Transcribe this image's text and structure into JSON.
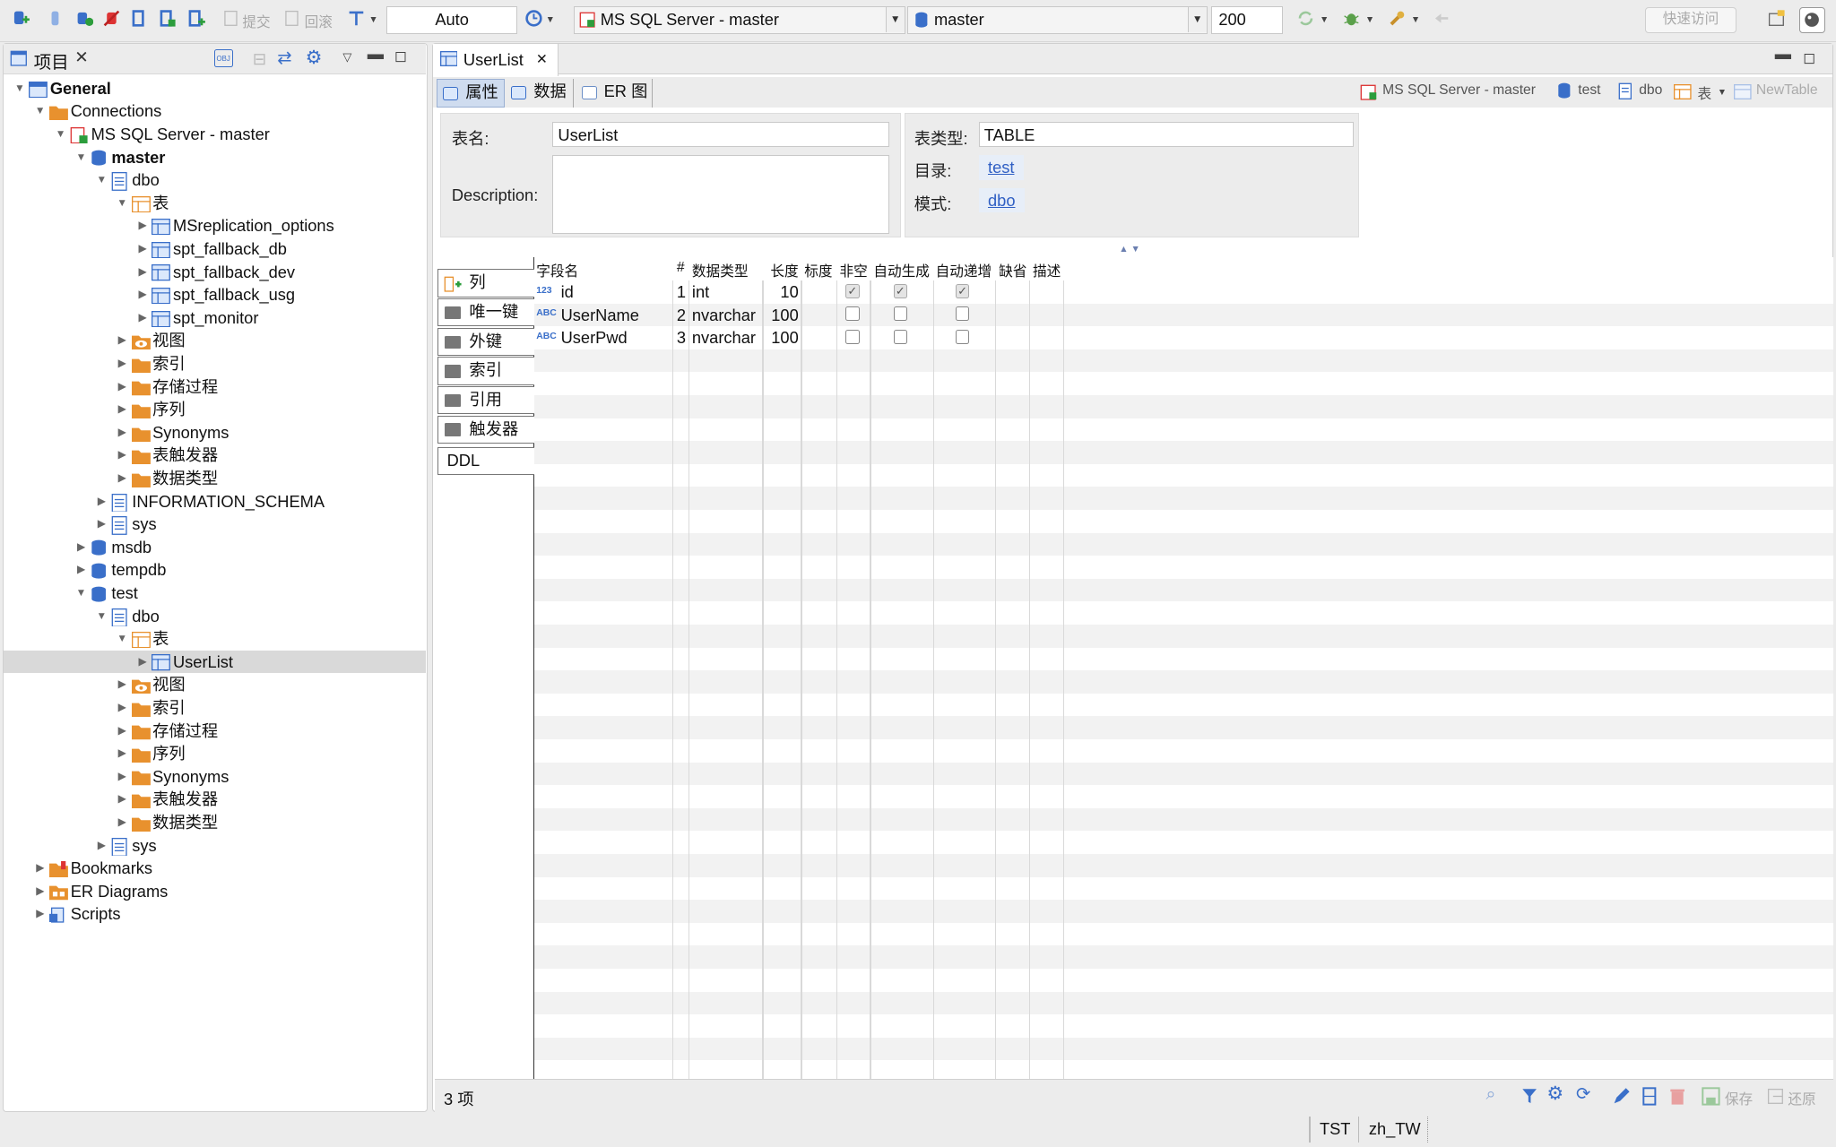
{
  "toolbar": {
    "commit_label": "提交",
    "rollback_label": "回滚",
    "mode_value": "Auto",
    "connection_value": "MS SQL Server - master",
    "database_value": "master",
    "limit_value": "200",
    "quick_access_placeholder": "快速访问"
  },
  "project_panel": {
    "title": "项目",
    "obj_badge": "OBJ",
    "tree": [
      {
        "label": "General",
        "level": 0,
        "twisty": "open",
        "icon": "general-icon",
        "bold": true
      },
      {
        "label": "Connections",
        "level": 1,
        "twisty": "open",
        "icon": "folder-icon"
      },
      {
        "label": "MS SQL Server - master",
        "level": 2,
        "twisty": "open",
        "icon": "server-icon"
      },
      {
        "label": "master",
        "level": 3,
        "twisty": "open",
        "icon": "database-icon",
        "bold": true
      },
      {
        "label": "dbo",
        "level": 4,
        "twisty": "open",
        "icon": "schema-icon"
      },
      {
        "label": "表",
        "level": 5,
        "twisty": "open",
        "icon": "tables-folder-icon"
      },
      {
        "label": "MSreplication_options",
        "level": 6,
        "twisty": "closed",
        "icon": "table-icon"
      },
      {
        "label": "spt_fallback_db",
        "level": 6,
        "twisty": "closed",
        "icon": "table-icon"
      },
      {
        "label": "spt_fallback_dev",
        "level": 6,
        "twisty": "closed",
        "icon": "table-icon"
      },
      {
        "label": "spt_fallback_usg",
        "level": 6,
        "twisty": "closed",
        "icon": "table-icon"
      },
      {
        "label": "spt_monitor",
        "level": 6,
        "twisty": "closed",
        "icon": "table-icon"
      },
      {
        "label": "视图",
        "level": 5,
        "twisty": "closed",
        "icon": "view-icon"
      },
      {
        "label": "索引",
        "level": 5,
        "twisty": "closed",
        "icon": "folder-icon"
      },
      {
        "label": "存储过程",
        "level": 5,
        "twisty": "closed",
        "icon": "folder-icon"
      },
      {
        "label": "序列",
        "level": 5,
        "twisty": "closed",
        "icon": "folder-icon"
      },
      {
        "label": "Synonyms",
        "level": 5,
        "twisty": "closed",
        "icon": "folder-icon"
      },
      {
        "label": "表触发器",
        "level": 5,
        "twisty": "closed",
        "icon": "folder-icon"
      },
      {
        "label": "数据类型",
        "level": 5,
        "twisty": "closed",
        "icon": "folder-icon"
      },
      {
        "label": "INFORMATION_SCHEMA",
        "level": 4,
        "twisty": "closed",
        "icon": "schema-icon"
      },
      {
        "label": "sys",
        "level": 4,
        "twisty": "closed",
        "icon": "schema-icon"
      },
      {
        "label": "msdb",
        "level": 3,
        "twisty": "closed",
        "icon": "database-icon"
      },
      {
        "label": "tempdb",
        "level": 3,
        "twisty": "closed",
        "icon": "database-icon"
      },
      {
        "label": "test",
        "level": 3,
        "twisty": "open",
        "icon": "database-icon"
      },
      {
        "label": "dbo",
        "level": 4,
        "twisty": "open",
        "icon": "schema-icon"
      },
      {
        "label": "表",
        "level": 5,
        "twisty": "open",
        "icon": "tables-folder-icon"
      },
      {
        "label": "UserList",
        "level": 6,
        "twisty": "closed",
        "icon": "table-icon",
        "selected": true
      },
      {
        "label": "视图",
        "level": 5,
        "twisty": "closed",
        "icon": "view-icon"
      },
      {
        "label": "索引",
        "level": 5,
        "twisty": "closed",
        "icon": "folder-icon"
      },
      {
        "label": "存储过程",
        "level": 5,
        "twisty": "closed",
        "icon": "folder-icon"
      },
      {
        "label": "序列",
        "level": 5,
        "twisty": "closed",
        "icon": "folder-icon"
      },
      {
        "label": "Synonyms",
        "level": 5,
        "twisty": "closed",
        "icon": "folder-icon"
      },
      {
        "label": "表触发器",
        "level": 5,
        "twisty": "closed",
        "icon": "folder-icon"
      },
      {
        "label": "数据类型",
        "level": 5,
        "twisty": "closed",
        "icon": "folder-icon"
      },
      {
        "label": "sys",
        "level": 4,
        "twisty": "closed",
        "icon": "schema-icon"
      },
      {
        "label": "Bookmarks",
        "level": 1,
        "twisty": "closed",
        "icon": "bookmarks-icon"
      },
      {
        "label": "ER Diagrams",
        "level": 1,
        "twisty": "closed",
        "icon": "er-diagrams-icon"
      },
      {
        "label": "Scripts",
        "level": 1,
        "twisty": "closed",
        "icon": "scripts-icon"
      }
    ]
  },
  "editor": {
    "tab_title": "UserList",
    "subtabs": [
      "属性",
      "数据",
      "ER 图"
    ],
    "breadcrumb": {
      "connection": "MS SQL Server - master",
      "database": "test",
      "schema": "dbo",
      "tables": "表",
      "new_table": "NewTable"
    },
    "properties": {
      "table_name_label": "表名:",
      "table_name_value": "UserList",
      "description_label": "Description:",
      "description_value": "",
      "table_type_label": "表类型:",
      "table_type_value": "TABLE",
      "catalog_label": "目录:",
      "catalog_value": "test",
      "schema_label": "模式:",
      "schema_value": "dbo"
    },
    "side_tabs": [
      "列",
      "唯一键",
      "外键",
      "索引",
      "引用",
      "触发器",
      "DDL"
    ],
    "columns_header": [
      "字段名",
      "#",
      "数据类型",
      "长度",
      "标度",
      "非空",
      "自动生成",
      "自动递增",
      "缺省",
      "描述"
    ],
    "columns": [
      {
        "type_badge": "123",
        "name": "id",
        "num": "1",
        "datatype": "int",
        "length": "10",
        "not_null": true,
        "auto_gen": true,
        "auto_inc": true
      },
      {
        "type_badge": "ABC",
        "name": "UserName",
        "num": "2",
        "datatype": "nvarchar",
        "length": "100",
        "not_null": false,
        "auto_gen": false,
        "auto_inc": false
      },
      {
        "type_badge": "ABC",
        "name": "UserPwd",
        "num": "3",
        "datatype": "nvarchar",
        "length": "100",
        "not_null": false,
        "auto_gen": false,
        "auto_inc": false
      }
    ],
    "status_count": "3 项",
    "save_label": "保存",
    "revert_label": "还原"
  },
  "statusbar": {
    "timezone": "TST",
    "locale": "zh_TW"
  },
  "colors": {
    "accent_blue": "#3a6fc9",
    "folder_orange": "#e8912e",
    "link_blue": "#2f5fc4"
  }
}
